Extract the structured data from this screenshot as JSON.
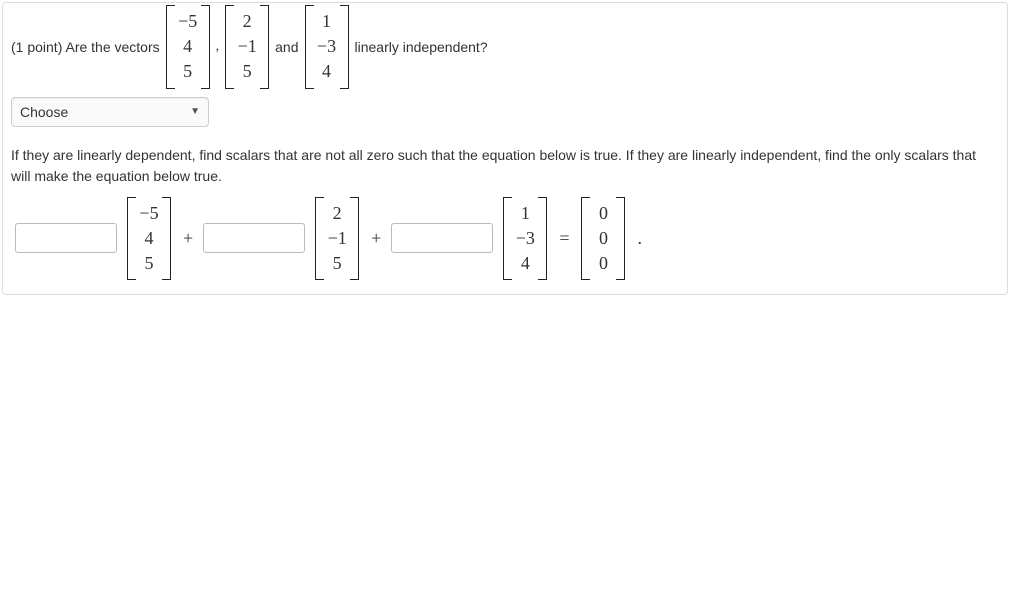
{
  "question": {
    "prefix": "(1 point) Are the vectors",
    "comma": ",",
    "and": "and",
    "suffix": "linearly independent?"
  },
  "vectors": {
    "v1": [
      "−5",
      "4",
      "5"
    ],
    "v2": [
      "2",
      "−1",
      "5"
    ],
    "v3": [
      "1",
      "−3",
      "4"
    ],
    "zero": [
      "0",
      "0",
      "0"
    ]
  },
  "dropdown": {
    "label": "Choose"
  },
  "instruction": "If they are linearly dependent, find scalars that are not all zero such that the equation below is true. If they are linearly independent, find the only scalars that will make the equation below true.",
  "ops": {
    "plus": "+",
    "equals": "=",
    "dot": "."
  }
}
